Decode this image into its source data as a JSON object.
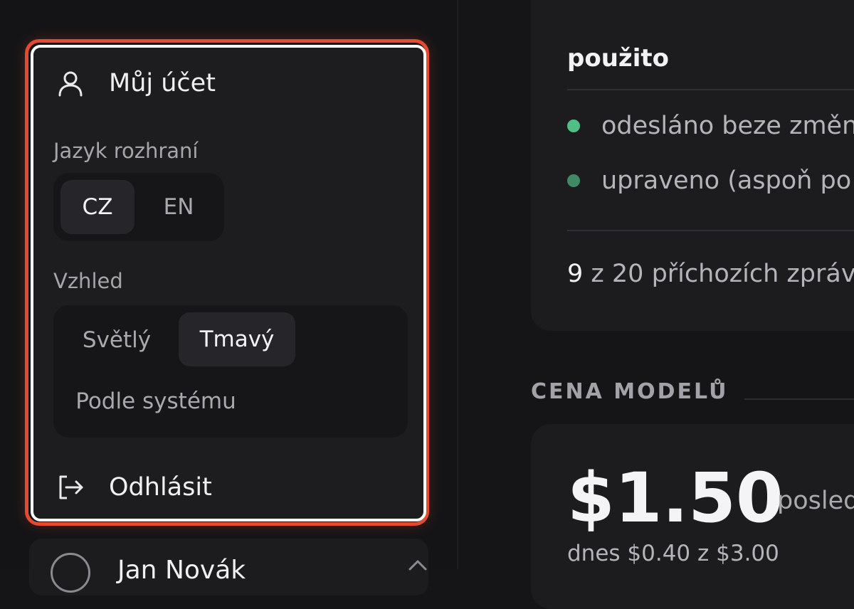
{
  "account_menu": {
    "account_label": "Můj účet",
    "language_label": "Jazyk rozhraní",
    "language_options": [
      "CZ",
      "EN"
    ],
    "language_selected": "CZ",
    "appearance_label": "Vzhled",
    "appearance_options": [
      "Světlý",
      "Tmavý",
      "Podle systému"
    ],
    "appearance_selected": "Tmavý",
    "logout_label": "Odhlásit"
  },
  "user": {
    "name": "Jan Novák"
  },
  "usage": {
    "title": "použito",
    "legend": [
      {
        "label": "odesláno beze změn",
        "color": "#4fbf84"
      },
      {
        "label": "upraveno (aspoň po",
        "color": "#3f8a64"
      }
    ],
    "count_value": "9",
    "count_suffix": "z 20 příchozích zpráv"
  },
  "model_price": {
    "heading": "CENA MODELŮ",
    "value": "$1.50",
    "value_suffix": "posled",
    "today": "dnes $0.40 z $3.00"
  },
  "colors": {
    "accent_green": "#4fbf84",
    "highlight": "#e34a2f"
  }
}
